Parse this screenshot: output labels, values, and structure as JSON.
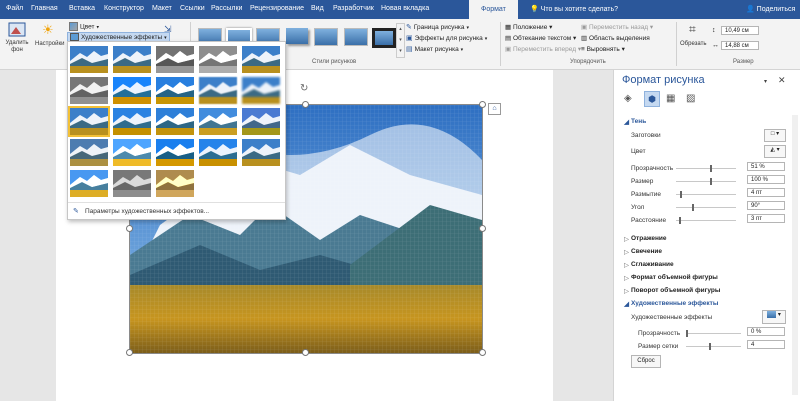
{
  "tabs": [
    "Файл",
    "Главная",
    "Вставка",
    "Конструктор",
    "Макет",
    "Ссылки",
    "Рассылки",
    "Рецензирование",
    "Вид",
    "Разработчик",
    "Новая вкладка",
    "Формат"
  ],
  "tell_me": "Что вы хотите сделать?",
  "share": "Поделиться",
  "ribbon": {
    "remove_bg": "Удалить фон",
    "corrections": "Настройки",
    "color": "Цвет",
    "artistic_effects": "Художественные эффекты",
    "picture_styles_label": "Стили рисунков",
    "border": "Граница рисунка",
    "effects": "Эффекты для рисунка",
    "layout": "Макет рисунка",
    "position": "Положение",
    "wrap_text": "Обтекание текстом",
    "bring_forward": "Переместить вперед",
    "send_backward": "Переместить назад",
    "selection_pane": "Область выделения",
    "align": "Выровнять",
    "arrange_label": "Упорядочить",
    "crop": "Обрезать",
    "height": "10,49 см",
    "width": "14,88 см",
    "size_label": "Размер"
  },
  "dropdown": {
    "options_link": "Параметры художественных эффектов...",
    "selected_index": 10
  },
  "panel": {
    "title": "Формат рисунка",
    "shadow": "Тень",
    "presets": "Заготовки",
    "color": "Цвет",
    "transparency": "Прозрачность",
    "transparency_val": "51 %",
    "size": "Размер",
    "size_val": "100 %",
    "blur": "Размытие",
    "blur_val": "4 пт",
    "angle": "Угол",
    "angle_val": "90°",
    "distance": "Расстояние",
    "distance_val": "3 пт",
    "reflection": "Отражение",
    "glow": "Свечение",
    "soft_edges": "Сглаживание",
    "format_3d": "Формат объемной фигуры",
    "rotation_3d": "Поворот объемной фигуры",
    "artistic": "Художественные эффекты",
    "artistic_label": "Художественные эффекты",
    "trans2": "Прозрачность",
    "trans2_val": "0 %",
    "grid_size": "Размер сетки",
    "grid_size_val": "4",
    "reset": "Сброс"
  }
}
